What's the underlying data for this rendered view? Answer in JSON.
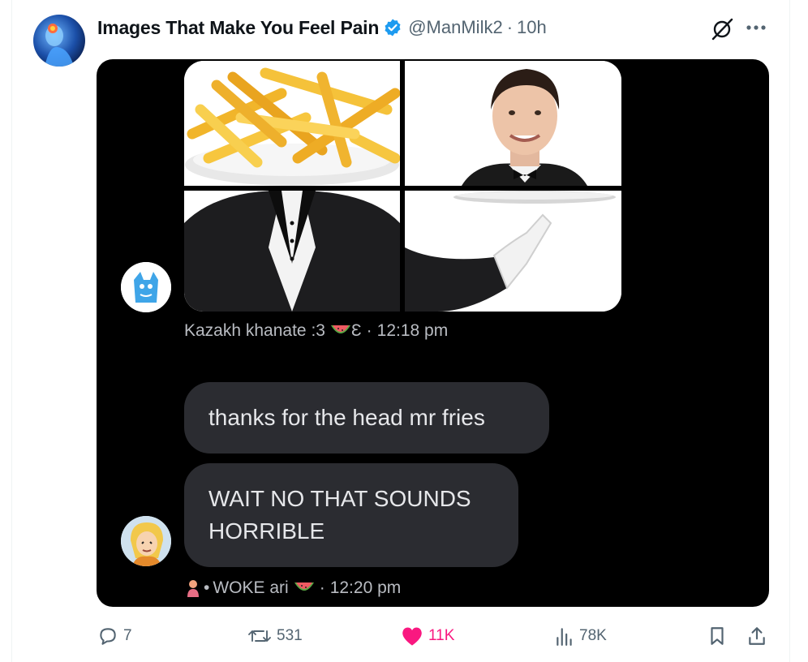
{
  "post": {
    "display_name": "Images That Make You Feel Pain",
    "handle": "@ManMilk2",
    "separator": "·",
    "time_ago": "10h"
  },
  "embedded": {
    "reply1": {
      "name": "Kazakh khanate :3",
      "suffix": "Ɛ",
      "time": "12:18 pm"
    },
    "message1": "thanks for the head mr fries",
    "message2": "WAIT NO THAT SOUNDS HORRIBLE",
    "reply2": {
      "prefix": "•",
      "name": "WOKE ari",
      "time": "12:20 pm"
    },
    "dot": "·"
  },
  "actions": {
    "replies": "7",
    "reposts": "531",
    "likes": "11K",
    "views": "78K"
  },
  "colors": {
    "accent_like": "#f91880",
    "verified_blue": "#1d9bf0",
    "muted": "#536471"
  },
  "icons": [
    "verified-icon",
    "grok-icon",
    "more-icon",
    "reply-icon",
    "repost-icon",
    "like-icon",
    "views-icon",
    "bookmark-icon",
    "share-icon",
    "watermelon-icon"
  ]
}
